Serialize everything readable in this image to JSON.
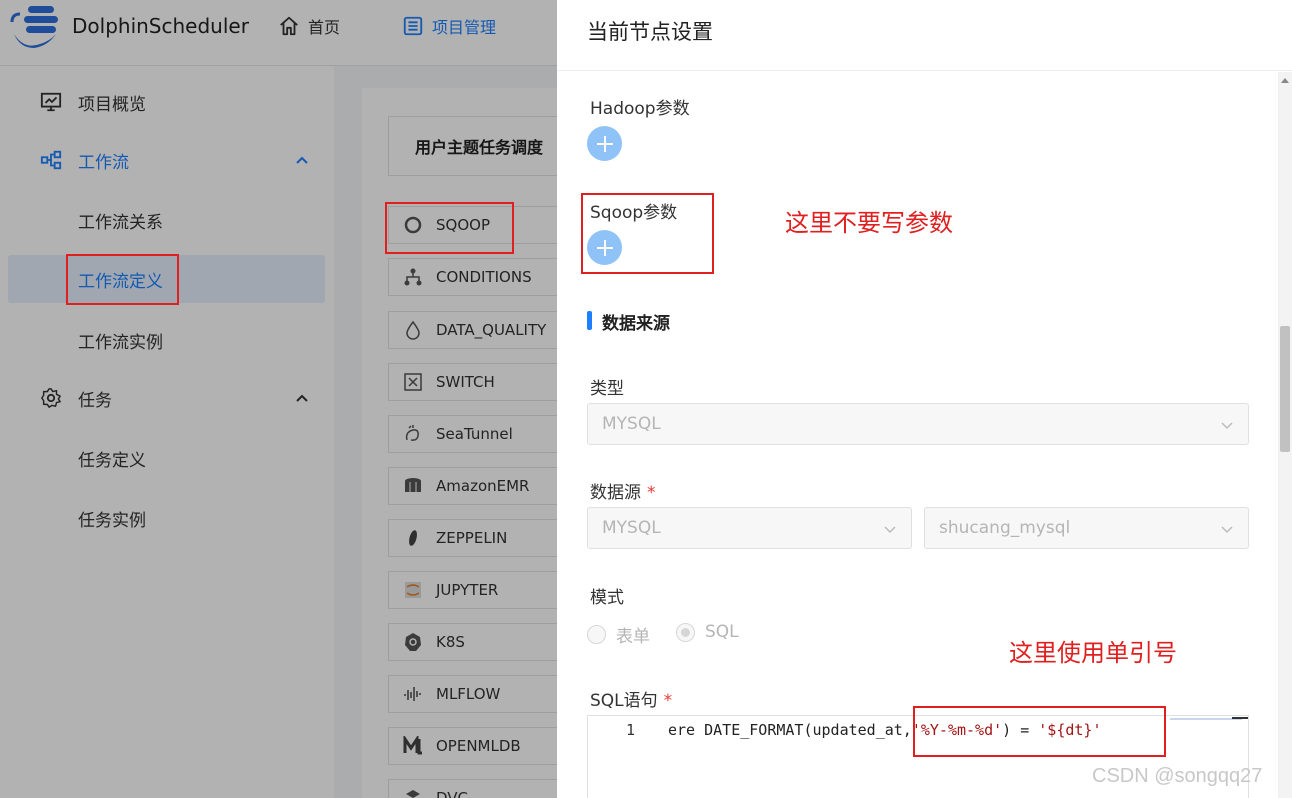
{
  "header": {
    "brand": "DolphinScheduler",
    "nav": [
      {
        "label": "首页",
        "icon": "home-icon"
      },
      {
        "label": "项目管理",
        "icon": "project-list-icon"
      }
    ]
  },
  "sidebar": {
    "items": [
      {
        "label": "项目概览",
        "icon": "monitor-chart-icon"
      },
      {
        "label": "工作流",
        "icon": "workflow-icon"
      },
      {
        "label": "工作流关系"
      },
      {
        "label": "工作流定义"
      },
      {
        "label": "工作流实例"
      },
      {
        "label": "任务",
        "icon": "gear-icon"
      },
      {
        "label": "任务定义"
      },
      {
        "label": "任务实例"
      }
    ]
  },
  "workflow_panel": {
    "title": "用户主题任务调度",
    "tasks": [
      {
        "label": "SQOOP",
        "icon": "sqoop-icon"
      },
      {
        "label": "CONDITIONS",
        "icon": "conditions-icon"
      },
      {
        "label": "DATA_QUALITY",
        "icon": "data-quality-icon"
      },
      {
        "label": "SWITCH",
        "icon": "switch-icon"
      },
      {
        "label": "SeaTunnel",
        "icon": "seatunnel-icon"
      },
      {
        "label": "AmazonEMR",
        "icon": "amazon-emr-icon"
      },
      {
        "label": "ZEPPELIN",
        "icon": "zeppelin-icon"
      },
      {
        "label": "JUPYTER",
        "icon": "jupyter-icon"
      },
      {
        "label": "K8S",
        "icon": "k8s-icon"
      },
      {
        "label": "MLFLOW",
        "icon": "mlflow-icon"
      },
      {
        "label": "OPENMLDB",
        "icon": "openmldb-icon"
      },
      {
        "label": "DVC",
        "icon": "dvc-icon"
      }
    ]
  },
  "drawer": {
    "title": "当前节点设置",
    "hadoop_label": "Hadoop参数",
    "sqoop_label": "Sqoop参数",
    "section_title": "数据来源",
    "type_label": "类型",
    "type_value": "MYSQL",
    "datasource_label": "数据源",
    "datasource_type": "MYSQL",
    "datasource_name": "shucang_mysql",
    "mode_label": "模式",
    "mode_options": [
      "表单",
      "SQL"
    ],
    "mode_selected": "SQL",
    "sql_label": "SQL语句",
    "editor": {
      "line_number": "1",
      "code_prefix": "ere DATE_FORMAT(updated_at,",
      "code_string1": "'%Y-%m-%d'",
      "code_middle": ") = ",
      "code_string2": "'${dt}'"
    }
  },
  "annotations": {
    "sqoop_note": "这里不要写参数",
    "sql_note": "这里使用单引号"
  },
  "watermark": "CSDN @songqq27",
  "colors": {
    "accent": "#1e80ff",
    "annotation_red": "#e02020",
    "plus_button": "#8fc2f7"
  }
}
